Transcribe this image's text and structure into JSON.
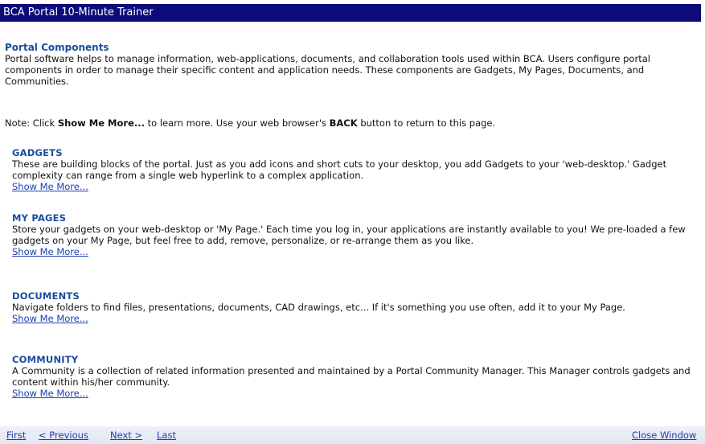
{
  "window": {
    "title": "BCA Portal 10-Minute Trainer"
  },
  "intro": {
    "heading": "Portal Components",
    "body": "Portal software helps to manage information, web-applications, documents, and collaboration tools used within BCA. Users configure portal components in order to manage their specific content and application needs. These components are Gadgets, My Pages, Documents, and Communities."
  },
  "note": {
    "prefix": "Note: Click ",
    "bold_link_text": "Show Me More...",
    "middle": " to learn more. Use your web browser's ",
    "bold_back": "BACK",
    "suffix": " button to return to this page."
  },
  "sections": [
    {
      "heading": "GADGETS",
      "body": "These are building blocks of the portal. Just as you add icons and short cuts to your desktop, you add Gadgets to your 'web-desktop.' Gadget complexity can range from a single web hyperlink to a complex application.",
      "link": "Show Me More..."
    },
    {
      "heading": "MY PAGES",
      "body": "Store your gadgets on your web-desktop or 'My Page.' Each time you log in, your applications are instantly available to you! We pre-loaded a few gadgets on your My Page, but feel free to add, remove, personalize, or re-arrange them as you like.",
      "link": "Show Me More..."
    },
    {
      "heading": "DOCUMENTS",
      "body": "Navigate folders to find files, presentations, documents, CAD drawings, etc... If it's something you use often, add it to your My Page.",
      "link": "Show Me More..."
    },
    {
      "heading": "COMMUNITY",
      "body": "A Community is a collection of related information presented and maintained by a Portal Community Manager. This Manager controls gadgets and content within his/her community.",
      "link": "Show Me More..."
    }
  ],
  "footer": {
    "first": "First",
    "previous": "< Previous",
    "next": "Next >",
    "last": "Last",
    "close": "Close Window"
  }
}
